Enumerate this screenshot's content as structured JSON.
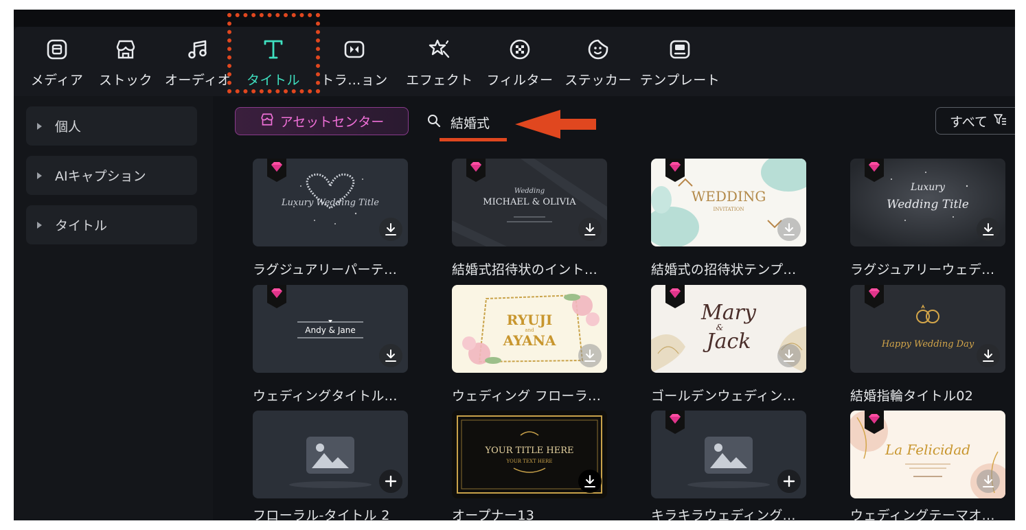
{
  "toolbar": {
    "tabs": [
      {
        "label": "メディア",
        "icon": "media-icon"
      },
      {
        "label": "ストック",
        "icon": "stock-icon"
      },
      {
        "label": "オーディオ",
        "icon": "audio-icon"
      },
      {
        "label": "タイトル",
        "icon": "title-icon",
        "active": true
      },
      {
        "label": "トラ…ョン",
        "icon": "transition-icon"
      },
      {
        "label": "エフェクト",
        "icon": "effects-icon"
      },
      {
        "label": "フィルター",
        "icon": "filter-icon"
      },
      {
        "label": "ステッカー",
        "icon": "sticker-icon"
      },
      {
        "label": "テンプレート",
        "icon": "template-icon"
      }
    ]
  },
  "sidebar": {
    "items": [
      {
        "label": "個人"
      },
      {
        "label": "AIキャプション"
      },
      {
        "label": "タイトル"
      }
    ]
  },
  "main": {
    "asset_center_label": "アセットセンター",
    "search_value": "結婚式",
    "filter_label": "すべて"
  },
  "colors": {
    "accent": "#3fe0c0",
    "annotation": "#e0471f",
    "asset_pink": "#f070d8",
    "premium_gem": "#ff4fa3"
  },
  "thumbs": {
    "t1": "Luxury Wedding Title",
    "t2_small": "Wedding",
    "t2_names": "MICHAEL & OLIVIA",
    "t3_main": "WEDDING",
    "t3_sub": "INVITATION",
    "t4_line1": "Luxury",
    "t4_line2": "Wedding Title",
    "t5": "Andy & Jane",
    "t6_line1": "RYUJI",
    "t6_and": "and",
    "t6_line2": "AYANA",
    "t7_line1": "Mary",
    "t7_and": "&",
    "t7_line2": "Jack",
    "t8": "Happy Wedding Day",
    "t10_main": "YOUR TITLE HERE",
    "t10_sub": "YOUR TEXT HERE",
    "t12": "La Felicidad"
  },
  "grid": [
    {
      "caption": "ラグジュアリーパーテ...",
      "premium": true,
      "action": "download"
    },
    {
      "caption": "結婚式招待状のイント...",
      "premium": true,
      "action": "download"
    },
    {
      "caption": "結婚式の招待状テンプ...",
      "premium": true,
      "action": "download"
    },
    {
      "caption": "ラグジュアリーウェデ...",
      "premium": true,
      "action": "download"
    },
    {
      "caption": "ウェディングタイトル...",
      "premium": true,
      "action": "download"
    },
    {
      "caption": "ウェディング フローラ...",
      "premium": false,
      "action": "download"
    },
    {
      "caption": "ゴールデンウェディン...",
      "premium": true,
      "action": "download"
    },
    {
      "caption": "結婚指輪タイトル02",
      "premium": true,
      "action": "download"
    },
    {
      "caption": "フローラル-タイトル 2",
      "premium": false,
      "action": "add"
    },
    {
      "caption": "オープナー13",
      "premium": false,
      "action": "download"
    },
    {
      "caption": "キラキラウェディング...",
      "premium": true,
      "action": "add"
    },
    {
      "caption": "ウェディングテーマオ...",
      "premium": true,
      "action": "download"
    }
  ]
}
